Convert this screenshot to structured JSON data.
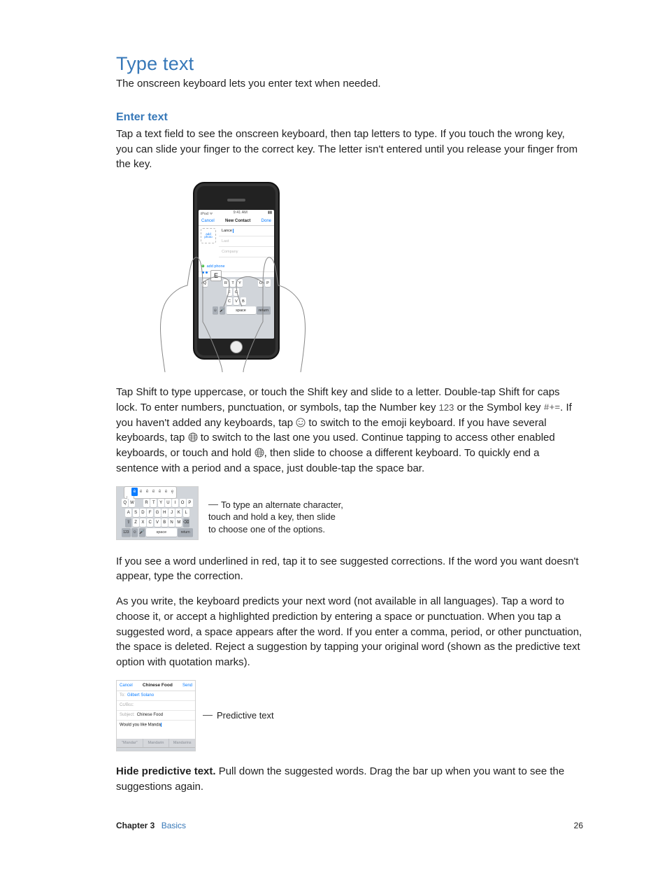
{
  "section": {
    "title": "Type text",
    "intro": "The onscreen keyboard lets you enter text when needed."
  },
  "enter": {
    "heading": "Enter text",
    "p1": "Tap a text field to see the onscreen keyboard, then tap letters to type. If you touch the wrong key, you can slide your finger to the correct key. The letter isn't entered until you release your finger from the key.",
    "p2a": "Tap Shift to type uppercase, or touch the Shift key and slide to a letter. Double-tap Shift for caps lock. To enter numbers, punctuation, or symbols, tap the Number key ",
    "key_123": "123",
    "p2b": " or the Symbol key ",
    "key_sym": "#+=",
    "p2c": ". If you haven't added any keyboards, tap ",
    "p2d": " to switch to the emoji keyboard. If you have several keyboards, tap ",
    "p2e": " to switch to the last one you used. Continue tapping to access other enabled keyboards, or touch and hold ",
    "p2f": ", then slide to choose a different keyboard. To quickly end a sentence with a period and a space, just double-tap the space bar.",
    "callout2a": "To type an alternate character,",
    "callout2b": "touch and hold a key, then slide",
    "callout2c": "to choose one of the options.",
    "p3": "If you see a word underlined in red, tap it to see suggested corrections. If the word you want doesn't appear, type the correction.",
    "p4": "As you write, the keyboard predicts your next word (not available in all languages). Tap a word to choose it, or accept a highlighted prediction by entering a space or punctuation. When you tap a suggested word, a space appears after the word. If you enter a comma, period, or other punctuation, the space is deleted. Reject a suggestion by tapping your original word (shown as the predictive text option with quotation marks).",
    "callout3": "Predictive text",
    "p5_lead": "Hide predictive text.",
    "p5": " Pull down the suggested words. Drag the bar up when you want to see the suggestions again."
  },
  "phone": {
    "time": "9:41 AM",
    "cancel": "Cancel",
    "title": "New Contact",
    "done": "Done",
    "addphoto": "add photo",
    "first_val": "Lance",
    "last_ph": "Last",
    "company_ph": "Company",
    "addphone": "add phone",
    "popup_letter": "E",
    "space": "space",
    "return": "return"
  },
  "altkb": {
    "popup": [
      "è",
      "é",
      "ê",
      "ë",
      "ē",
      "ė",
      "ę"
    ],
    "row1": [
      "Q",
      "W",
      "E",
      "R",
      "T",
      "Y",
      "U",
      "I",
      "O",
      "P"
    ],
    "row2": [
      "A",
      "S",
      "D",
      "F",
      "G",
      "H",
      "J",
      "K",
      "L"
    ],
    "row3": [
      "Z",
      "X",
      "C",
      "V",
      "B",
      "N",
      "M"
    ],
    "numkey": "123",
    "space": "space",
    "return": "return"
  },
  "mail": {
    "cancel": "Cancel",
    "title": "Chinese Food",
    "send": "Send",
    "to_lab": "To:",
    "to_val": "Gilbert Solano",
    "cc_lab": "Cc/Bcc:",
    "subj_lab": "Subject:",
    "subj_val": "Chinese Food",
    "body": "Would you like Manda",
    "sug1": "\"Mandar\"",
    "sug2": "Mandarin",
    "sug3": "Mandarins"
  },
  "footer": {
    "chapter_label": "Chapter  3",
    "chapter_name": "Basics",
    "page": "26"
  }
}
